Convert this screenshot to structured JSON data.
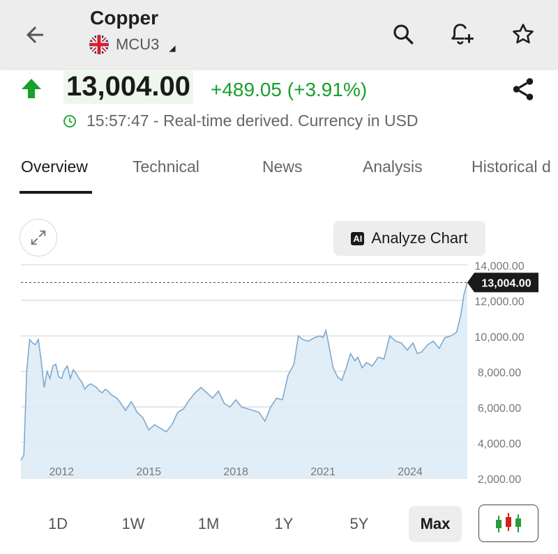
{
  "header": {
    "title": "Copper",
    "symbol": "MCU3"
  },
  "quote": {
    "price": "13,004.00",
    "change": "+489.05 (+3.91%)",
    "status": "15:57:47 - Real-time derived. Currency in USD",
    "up_color": "#17a02b"
  },
  "tabs": [
    {
      "label": "Overview"
    },
    {
      "label": "Technical"
    },
    {
      "label": "News"
    },
    {
      "label": "Analysis"
    },
    {
      "label": "Historical d"
    }
  ],
  "chart_toolbar": {
    "ai_badge": "AI",
    "analyze_label": "Analyze Chart"
  },
  "chart_data": {
    "type": "area",
    "title": "",
    "xlabel": "",
    "ylabel": "",
    "ylim": [
      2000,
      14000
    ],
    "y_ticks": [
      "14,000.00",
      "12,000.00",
      "10,000.00",
      "8,000.00",
      "6,000.00",
      "4,000.00",
      "2,000.00"
    ],
    "y_tick_values": [
      14000,
      12000,
      10000,
      8000,
      6000,
      4000,
      2000
    ],
    "x_ticks": [
      "2012",
      "2015",
      "2018",
      "2021",
      "2024"
    ],
    "x_tick_values": [
      2012,
      2015,
      2018,
      2021,
      2024
    ],
    "xlim": [
      2010.6,
      2025.97
    ],
    "current_value_label": "13,004.00",
    "current_value": 13004,
    "line_color": "#7fa8cc",
    "fill_color": "#dcebf7",
    "series": [
      {
        "x": [
          2010.6,
          2010.7,
          2010.8,
          2010.9,
          2011.0,
          2011.1,
          2011.2,
          2011.3,
          2011.4,
          2011.5,
          2011.6,
          2011.7,
          2011.8,
          2011.9,
          2012.0,
          2012.1,
          2012.2,
          2012.3,
          2012.4,
          2012.5,
          2012.6,
          2012.7,
          2012.8,
          2012.9,
          2013.0,
          2013.1,
          2013.2,
          2013.3,
          2013.4,
          2013.5,
          2013.6,
          2013.7,
          2013.8,
          2013.9,
          2014.0,
          2014.2,
          2014.4,
          2014.6,
          2014.8,
          2015.0,
          2015.2,
          2015.4,
          2015.6,
          2015.8,
          2016.0,
          2016.2,
          2016.4,
          2016.6,
          2016.8,
          2017.0,
          2017.2,
          2017.4,
          2017.6,
          2017.8,
          2018.0,
          2018.2,
          2018.4,
          2018.6,
          2018.8,
          2019.0,
          2019.2,
          2019.4,
          2019.6,
          2019.8,
          2020.0,
          2020.15,
          2020.3,
          2020.5,
          2020.7,
          2020.9,
          2021.0,
          2021.1,
          2021.2,
          2021.35,
          2021.5,
          2021.65,
          2021.8,
          2021.95,
          2022.1,
          2022.2,
          2022.35,
          2022.5,
          2022.7,
          2022.9,
          2023.1,
          2023.3,
          2023.5,
          2023.7,
          2023.9,
          2024.1,
          2024.25,
          2024.4,
          2024.6,
          2024.8,
          2025.0,
          2025.2,
          2025.4,
          2025.6,
          2025.75,
          2025.85,
          2025.97
        ],
        "y": [
          3000,
          3300,
          8000,
          9800,
          9600,
          9500,
          9800,
          8600,
          7100,
          8000,
          7600,
          8300,
          8400,
          7700,
          7600,
          8100,
          8300,
          7600,
          8100,
          7900,
          7600,
          7400,
          7000,
          7200,
          7300,
          7200,
          7100,
          6900,
          6800,
          7000,
          6900,
          6700,
          6600,
          6500,
          6300,
          5800,
          6300,
          5700,
          5400,
          4700,
          5000,
          4800,
          4600,
          5000,
          5700,
          5900,
          6400,
          6800,
          7100,
          6800,
          6500,
          6900,
          6200,
          6000,
          6400,
          6000,
          5900,
          5800,
          5700,
          5200,
          6000,
          6500,
          6400,
          7800,
          8400,
          10000,
          9800,
          9700,
          9900,
          10000,
          9900,
          10300,
          9500,
          8200,
          7700,
          7500,
          8200,
          9000,
          8600,
          8800,
          8200,
          8500,
          8300,
          8800,
          8700,
          10000,
          9700,
          9600,
          9200,
          9600,
          9000,
          9100,
          9500,
          9700,
          9300,
          9900,
          10000,
          10200,
          11200,
          12300,
          13004
        ]
      }
    ]
  },
  "ranges": [
    {
      "label": "1D"
    },
    {
      "label": "1W"
    },
    {
      "label": "1M"
    },
    {
      "label": "1Y"
    },
    {
      "label": "5Y"
    },
    {
      "label": "Max",
      "active": true
    }
  ],
  "icons": {
    "back": "arrow-left-icon",
    "search": "search-icon",
    "alert": "bell-plus-icon",
    "favorite": "star-icon",
    "share": "share-icon",
    "clock": "clock-icon",
    "expand": "expand-icon",
    "candles": "candlestick-icon"
  }
}
